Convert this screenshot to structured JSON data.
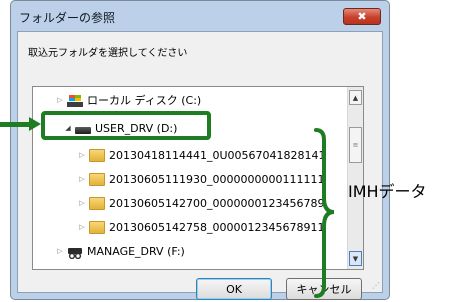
{
  "dialog": {
    "title": "フォルダーの参照",
    "close_label": "✖",
    "instruction": "取込元フォルダを選択してください",
    "ok_label": "OK",
    "cancel_label": "キャンセル"
  },
  "tree": {
    "items": [
      {
        "label": "ローカル ディスク (C:)",
        "icon": "drive-icon",
        "expanded": false
      },
      {
        "label": "USER_DRV (D:)",
        "icon": "drive-icon",
        "expanded": true
      },
      {
        "label": "20130418114441_0U00567041828141",
        "icon": "folder-icon",
        "expanded": false
      },
      {
        "label": "20130605111930_0000000000111111",
        "icon": "folder-icon",
        "expanded": false
      },
      {
        "label": "20130605142700_0000000123456789",
        "icon": "folder-icon",
        "expanded": false
      },
      {
        "label": "20130605142758_0000012345678911",
        "icon": "folder-icon",
        "expanded": false
      },
      {
        "label": "MANAGE_DRV (F:)",
        "icon": "network-drive-icon",
        "expanded": false
      }
    ]
  },
  "annotation": {
    "label": "IMHデータ",
    "color": "#1e7d22"
  }
}
